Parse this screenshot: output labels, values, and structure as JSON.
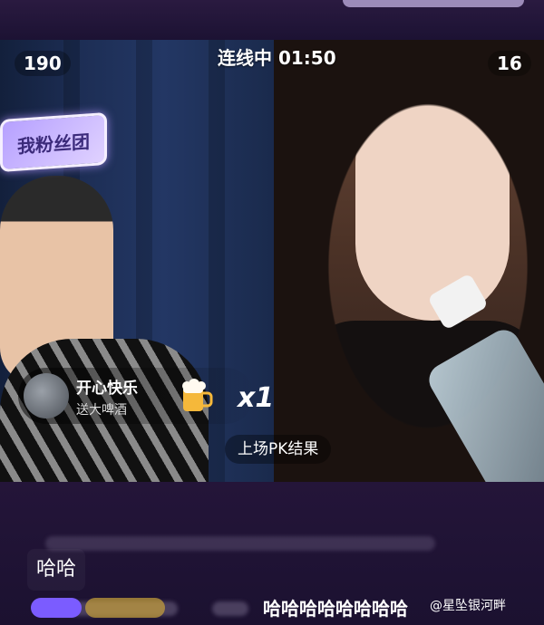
{
  "header": {
    "left_count": "190",
    "timer": "连线中 01:50",
    "right_count": "16"
  },
  "fan_badge": {
    "label": "我粉丝团"
  },
  "gift": {
    "sender_name": "开心快乐",
    "message": "送大啤酒",
    "multiplier": "x1",
    "icon": "beer-mug-icon"
  },
  "pk_result": {
    "label": "上场PK结果"
  },
  "chat": {
    "message": "哈哈",
    "bottom_message": "哈哈哈哈哈哈哈哈"
  },
  "watermark": "@星坠银河畔",
  "colors": {
    "background": "#1a1030",
    "fan_badge": "#b6a0ff"
  }
}
